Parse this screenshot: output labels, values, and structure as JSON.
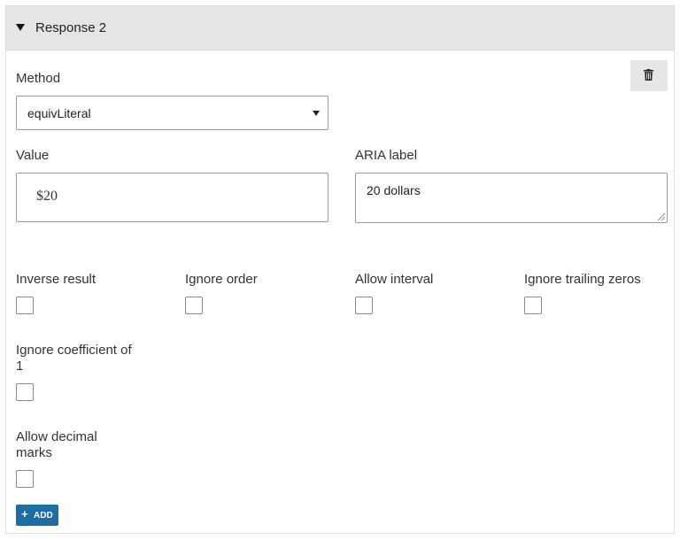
{
  "panel": {
    "title": "Response 2"
  },
  "method": {
    "label": "Method",
    "selected": "equivLiteral"
  },
  "delete": {
    "icon": "trash-icon"
  },
  "value": {
    "label": "Value",
    "text": "$20"
  },
  "aria": {
    "label": "ARIA label",
    "text": "20 dollars"
  },
  "options": [
    {
      "label": "Inverse result",
      "checked": false
    },
    {
      "label": "Ignore order",
      "checked": false
    },
    {
      "label": "Allow interval",
      "checked": false
    },
    {
      "label": "Ignore trailing zeros",
      "checked": false
    },
    {
      "label_line1": "Ignore coefficient of",
      "label_line2": "1",
      "checked": false
    },
    {
      "label_line1": "Allow decimal",
      "label_line2": "marks",
      "checked": false
    }
  ],
  "add_button": {
    "icon_text": "+",
    "label": "ADD"
  },
  "colors": {
    "header_bg": "#e5e5e5",
    "add_button_bg": "#1c6da6"
  }
}
